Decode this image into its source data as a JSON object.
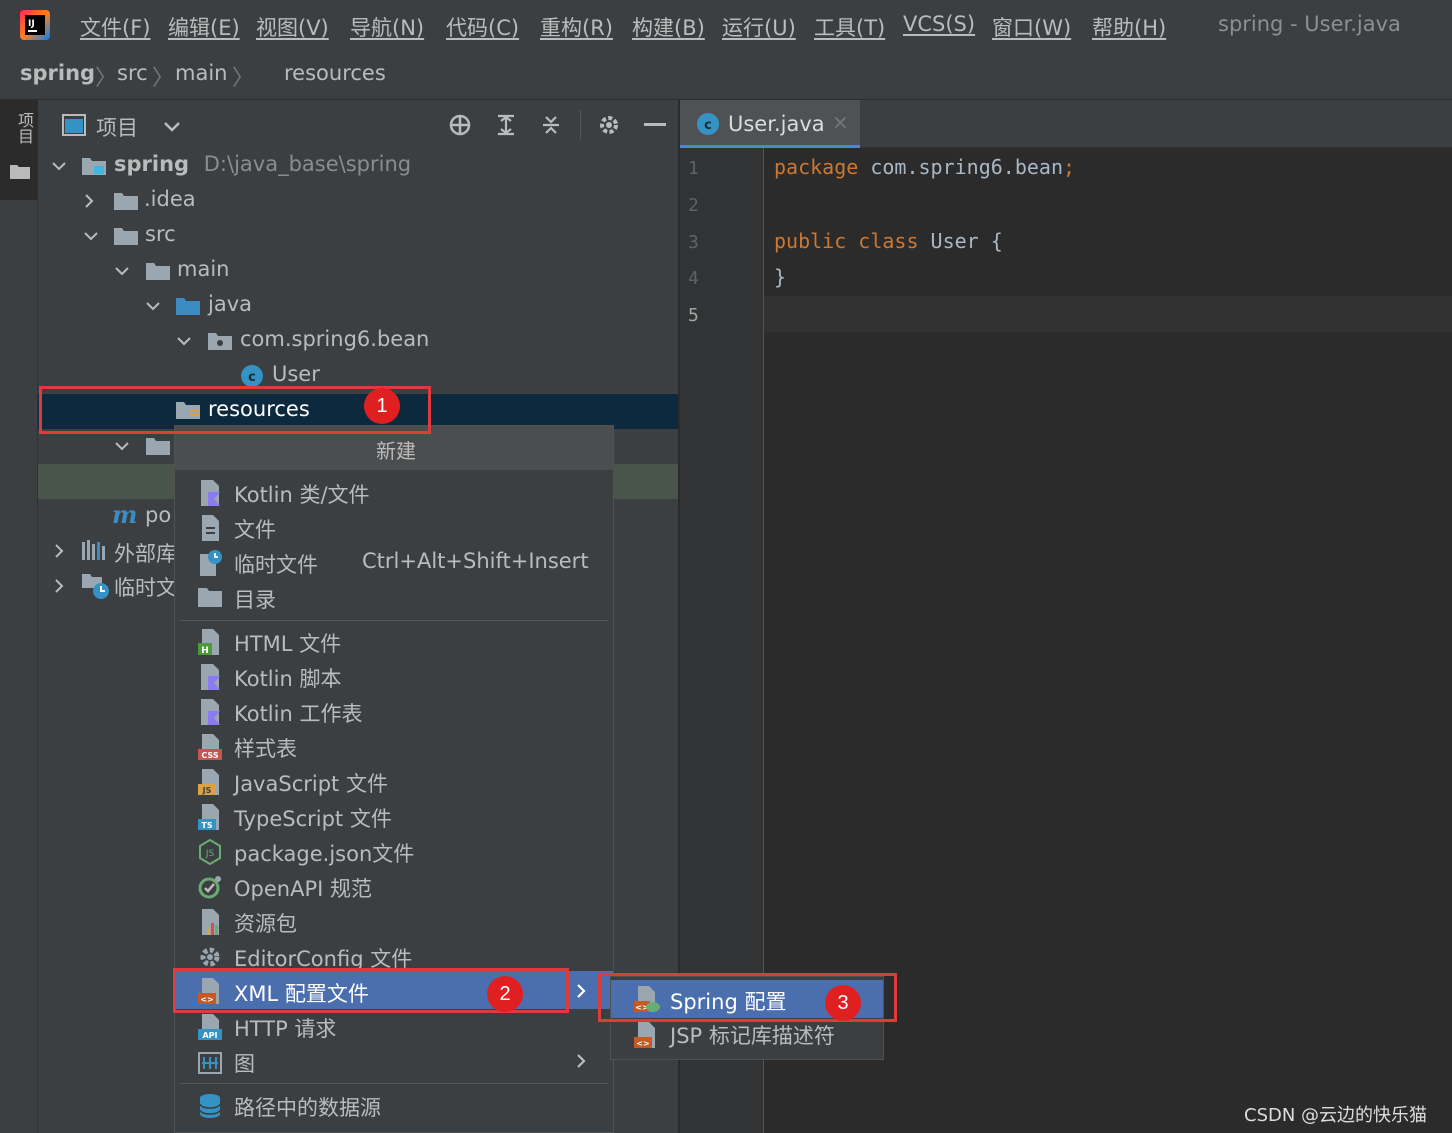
{
  "menubar": {
    "items": [
      "文件(F)",
      "编辑(E)",
      "视图(V)",
      "导航(N)",
      "代码(C)",
      "重构(R)",
      "构建(B)",
      "运行(U)",
      "工具(T)",
      "VCS(S)",
      "窗口(W)",
      "帮助(H)"
    ],
    "window_title": "spring - User.java"
  },
  "breadcrumb": [
    "spring",
    "src",
    "main",
    "resources"
  ],
  "left_strip": {
    "label": "项目"
  },
  "project_panel": {
    "title": "项目",
    "tree": {
      "root_name": "spring",
      "root_path": "D:\\java_base\\spring",
      "idea": ".idea",
      "src": "src",
      "main": "main",
      "java": "java",
      "package": "com.spring6.bean",
      "class": "User",
      "resources": "resources",
      "pom_partial": "po",
      "external_partial": "外部库",
      "scratch_partial": "临时文"
    }
  },
  "editor": {
    "tab_label": "User.java",
    "line_numbers": [
      "1",
      "2",
      "3",
      "4",
      "5"
    ],
    "code": {
      "l1_kw": "package",
      "l1_rest": " com.spring6.bean",
      "l1_semi": ";",
      "l3_kw": "public class",
      "l3_name": " User",
      "l3_brace": " {",
      "l4": "}"
    }
  },
  "context_menu": {
    "header": "新建",
    "items": {
      "kotlin_class": "Kotlin 类/文件",
      "file": "文件",
      "scratch": "临时文件",
      "scratch_shortcut": "Ctrl+Alt+Shift+Insert",
      "directory": "目录",
      "html": "HTML 文件",
      "kotlin_script": "Kotlin 脚本",
      "kotlin_worksheet": "Kotlin 工作表",
      "stylesheet": "样式表",
      "javascript": "JavaScript 文件",
      "typescript": "TypeScript 文件",
      "package_json": "package.json文件",
      "openapi": "OpenAPI 规范",
      "resource_bundle": "资源包",
      "editorconfig": "EditorConfig 文件",
      "xml_config": "XML 配置文件",
      "http_request": "HTTP 请求",
      "diagram": "图",
      "datasource": "路径中的数据源"
    }
  },
  "submenu": {
    "spring_config": "Spring 配置",
    "jsp_tld": "JSP 标记库描述符"
  },
  "annotations": {
    "badge1": "1",
    "badge2": "2",
    "badge3": "3"
  },
  "watermark": "CSDN @云边的快乐猫",
  "colors": {
    "accent": "#4b6eaf",
    "selection": "#0d293e",
    "annotation": "#e03a3a",
    "keyword": "#cc7832"
  }
}
